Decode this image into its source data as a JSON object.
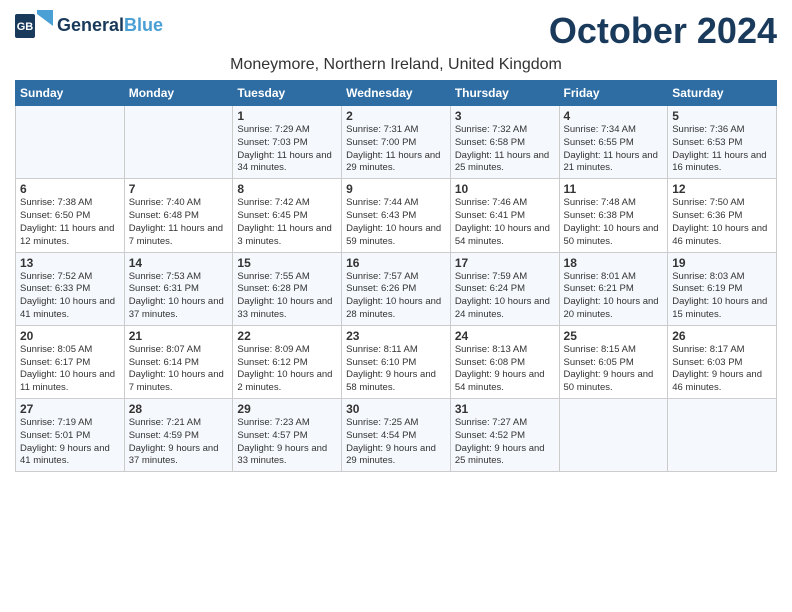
{
  "logo": {
    "general": "General",
    "blue": "Blue",
    "icon_color": "#4a9fd4"
  },
  "title": "October 2024",
  "location": "Moneymore, Northern Ireland, United Kingdom",
  "days_header": [
    "Sunday",
    "Monday",
    "Tuesday",
    "Wednesday",
    "Thursday",
    "Friday",
    "Saturday"
  ],
  "weeks": [
    [
      {
        "day": "",
        "sunrise": "",
        "sunset": "",
        "daylight": ""
      },
      {
        "day": "",
        "sunrise": "",
        "sunset": "",
        "daylight": ""
      },
      {
        "day": "1",
        "sunrise": "Sunrise: 7:29 AM",
        "sunset": "Sunset: 7:03 PM",
        "daylight": "Daylight: 11 hours and 34 minutes."
      },
      {
        "day": "2",
        "sunrise": "Sunrise: 7:31 AM",
        "sunset": "Sunset: 7:00 PM",
        "daylight": "Daylight: 11 hours and 29 minutes."
      },
      {
        "day": "3",
        "sunrise": "Sunrise: 7:32 AM",
        "sunset": "Sunset: 6:58 PM",
        "daylight": "Daylight: 11 hours and 25 minutes."
      },
      {
        "day": "4",
        "sunrise": "Sunrise: 7:34 AM",
        "sunset": "Sunset: 6:55 PM",
        "daylight": "Daylight: 11 hours and 21 minutes."
      },
      {
        "day": "5",
        "sunrise": "Sunrise: 7:36 AM",
        "sunset": "Sunset: 6:53 PM",
        "daylight": "Daylight: 11 hours and 16 minutes."
      }
    ],
    [
      {
        "day": "6",
        "sunrise": "Sunrise: 7:38 AM",
        "sunset": "Sunset: 6:50 PM",
        "daylight": "Daylight: 11 hours and 12 minutes."
      },
      {
        "day": "7",
        "sunrise": "Sunrise: 7:40 AM",
        "sunset": "Sunset: 6:48 PM",
        "daylight": "Daylight: 11 hours and 7 minutes."
      },
      {
        "day": "8",
        "sunrise": "Sunrise: 7:42 AM",
        "sunset": "Sunset: 6:45 PM",
        "daylight": "Daylight: 11 hours and 3 minutes."
      },
      {
        "day": "9",
        "sunrise": "Sunrise: 7:44 AM",
        "sunset": "Sunset: 6:43 PM",
        "daylight": "Daylight: 10 hours and 59 minutes."
      },
      {
        "day": "10",
        "sunrise": "Sunrise: 7:46 AM",
        "sunset": "Sunset: 6:41 PM",
        "daylight": "Daylight: 10 hours and 54 minutes."
      },
      {
        "day": "11",
        "sunrise": "Sunrise: 7:48 AM",
        "sunset": "Sunset: 6:38 PM",
        "daylight": "Daylight: 10 hours and 50 minutes."
      },
      {
        "day": "12",
        "sunrise": "Sunrise: 7:50 AM",
        "sunset": "Sunset: 6:36 PM",
        "daylight": "Daylight: 10 hours and 46 minutes."
      }
    ],
    [
      {
        "day": "13",
        "sunrise": "Sunrise: 7:52 AM",
        "sunset": "Sunset: 6:33 PM",
        "daylight": "Daylight: 10 hours and 41 minutes."
      },
      {
        "day": "14",
        "sunrise": "Sunrise: 7:53 AM",
        "sunset": "Sunset: 6:31 PM",
        "daylight": "Daylight: 10 hours and 37 minutes."
      },
      {
        "day": "15",
        "sunrise": "Sunrise: 7:55 AM",
        "sunset": "Sunset: 6:28 PM",
        "daylight": "Daylight: 10 hours and 33 minutes."
      },
      {
        "day": "16",
        "sunrise": "Sunrise: 7:57 AM",
        "sunset": "Sunset: 6:26 PM",
        "daylight": "Daylight: 10 hours and 28 minutes."
      },
      {
        "day": "17",
        "sunrise": "Sunrise: 7:59 AM",
        "sunset": "Sunset: 6:24 PM",
        "daylight": "Daylight: 10 hours and 24 minutes."
      },
      {
        "day": "18",
        "sunrise": "Sunrise: 8:01 AM",
        "sunset": "Sunset: 6:21 PM",
        "daylight": "Daylight: 10 hours and 20 minutes."
      },
      {
        "day": "19",
        "sunrise": "Sunrise: 8:03 AM",
        "sunset": "Sunset: 6:19 PM",
        "daylight": "Daylight: 10 hours and 15 minutes."
      }
    ],
    [
      {
        "day": "20",
        "sunrise": "Sunrise: 8:05 AM",
        "sunset": "Sunset: 6:17 PM",
        "daylight": "Daylight: 10 hours and 11 minutes."
      },
      {
        "day": "21",
        "sunrise": "Sunrise: 8:07 AM",
        "sunset": "Sunset: 6:14 PM",
        "daylight": "Daylight: 10 hours and 7 minutes."
      },
      {
        "day": "22",
        "sunrise": "Sunrise: 8:09 AM",
        "sunset": "Sunset: 6:12 PM",
        "daylight": "Daylight: 10 hours and 2 minutes."
      },
      {
        "day": "23",
        "sunrise": "Sunrise: 8:11 AM",
        "sunset": "Sunset: 6:10 PM",
        "daylight": "Daylight: 9 hours and 58 minutes."
      },
      {
        "day": "24",
        "sunrise": "Sunrise: 8:13 AM",
        "sunset": "Sunset: 6:08 PM",
        "daylight": "Daylight: 9 hours and 54 minutes."
      },
      {
        "day": "25",
        "sunrise": "Sunrise: 8:15 AM",
        "sunset": "Sunset: 6:05 PM",
        "daylight": "Daylight: 9 hours and 50 minutes."
      },
      {
        "day": "26",
        "sunrise": "Sunrise: 8:17 AM",
        "sunset": "Sunset: 6:03 PM",
        "daylight": "Daylight: 9 hours and 46 minutes."
      }
    ],
    [
      {
        "day": "27",
        "sunrise": "Sunrise: 7:19 AM",
        "sunset": "Sunset: 5:01 PM",
        "daylight": "Daylight: 9 hours and 41 minutes."
      },
      {
        "day": "28",
        "sunrise": "Sunrise: 7:21 AM",
        "sunset": "Sunset: 4:59 PM",
        "daylight": "Daylight: 9 hours and 37 minutes."
      },
      {
        "day": "29",
        "sunrise": "Sunrise: 7:23 AM",
        "sunset": "Sunset: 4:57 PM",
        "daylight": "Daylight: 9 hours and 33 minutes."
      },
      {
        "day": "30",
        "sunrise": "Sunrise: 7:25 AM",
        "sunset": "Sunset: 4:54 PM",
        "daylight": "Daylight: 9 hours and 29 minutes."
      },
      {
        "day": "31",
        "sunrise": "Sunrise: 7:27 AM",
        "sunset": "Sunset: 4:52 PM",
        "daylight": "Daylight: 9 hours and 25 minutes."
      },
      {
        "day": "",
        "sunrise": "",
        "sunset": "",
        "daylight": ""
      },
      {
        "day": "",
        "sunrise": "",
        "sunset": "",
        "daylight": ""
      }
    ]
  ]
}
